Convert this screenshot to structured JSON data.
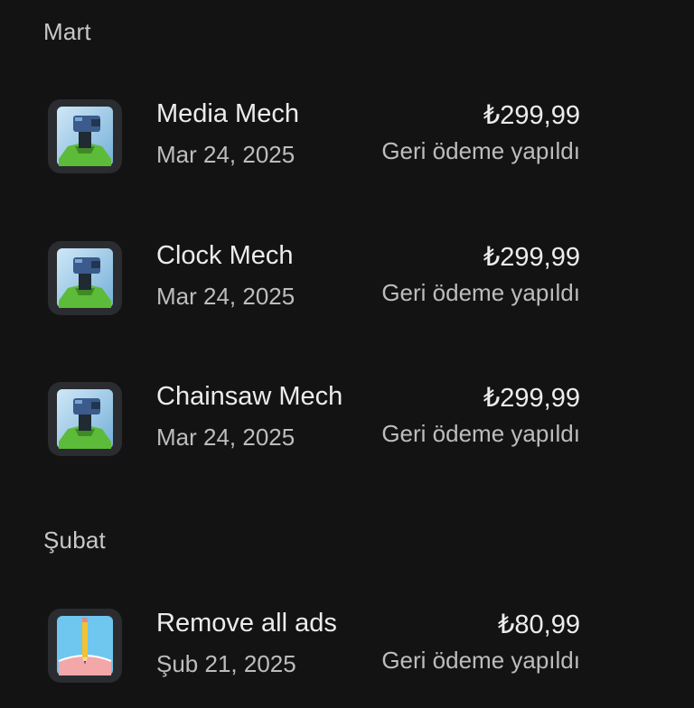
{
  "sections": [
    {
      "header": "Mart",
      "items": [
        {
          "title": "Media Mech",
          "date": "Mar 24, 2025",
          "price": "₺299,99",
          "status": "Geri ödeme yapıldı",
          "icon": "mech-character-icon"
        },
        {
          "title": "Clock Mech",
          "date": "Mar 24, 2025",
          "price": "₺299,99",
          "status": "Geri ödeme yapıldı",
          "icon": "mech-character-icon"
        },
        {
          "title": "Chainsaw Mech",
          "date": "Mar 24, 2025",
          "price": "₺299,99",
          "status": "Geri ödeme yapıldı",
          "icon": "mech-character-icon"
        }
      ]
    },
    {
      "header": "Şubat",
      "items": [
        {
          "title": "Remove all ads",
          "date": "Şub 21, 2025",
          "price": "₺80,99",
          "status": "Geri ödeme yapıldı",
          "icon": "notebook-pencil-icon"
        }
      ]
    }
  ],
  "colors": {
    "background": "#131313",
    "primary_text": "#ececec",
    "secondary_text": "#bdbdbd"
  }
}
